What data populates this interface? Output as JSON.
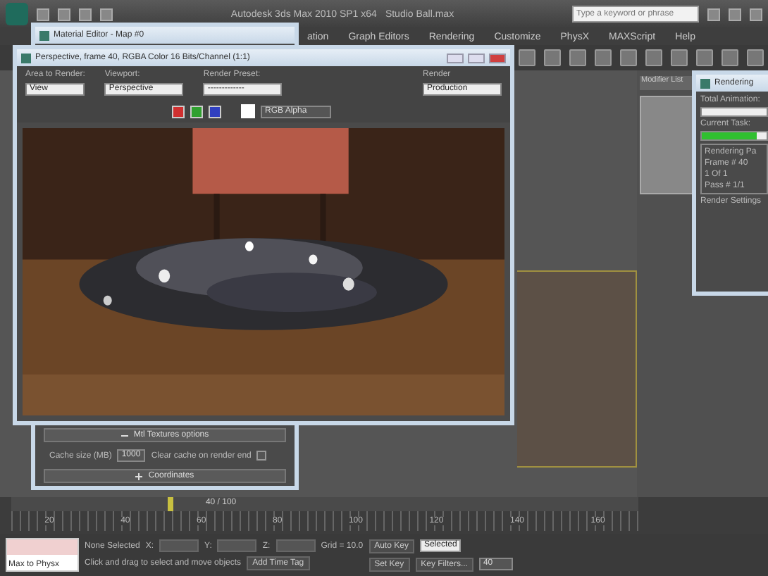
{
  "app": {
    "title": "Autodesk 3ds Max 2010 SP1 x64",
    "file": "Studio Ball.max",
    "search": {
      "placeholder": "Type a keyword or phrase"
    }
  },
  "menu": [
    "ation",
    "Graph Editors",
    "Rendering",
    "Customize",
    "PhysX",
    "MAXScript",
    "Help"
  ],
  "material_editor": {
    "title": "Material Editor - Map #0",
    "rollouts": [
      {
        "title": "Mtl Textures options",
        "expanded": true
      },
      {
        "title": "Coordinates",
        "expanded": false
      }
    ],
    "cache_label": "Cache size (MB)",
    "cache_value": "1000",
    "clear_label": "Clear cache on render end",
    "clear_checked": false
  },
  "frame_window": {
    "title": "Perspective, frame 40, RGBA Color 16 Bits/Channel (1:1)",
    "area_label": "Area to Render:",
    "area_value": "View",
    "viewport_label": "Viewport:",
    "viewport_value": "Perspective",
    "preset_label": "Render Preset:",
    "preset_value": "-------------",
    "render_label": "Render",
    "render_value": "Production",
    "channels": [
      {
        "color": "#d03030",
        "on": true
      },
      {
        "color": "#30a030",
        "on": true
      },
      {
        "color": "#3040c0",
        "on": true
      }
    ],
    "channel_mode": "RGB Alpha"
  },
  "command_panel": {
    "label": "Modifier List"
  },
  "rendering_dialog": {
    "title": "Rendering",
    "total_label": "Total Animation:",
    "total": {
      "level": 0.0
    },
    "task_label": "Current Task:",
    "task": {
      "level": 0.85
    },
    "group_title": "Rendering Pa",
    "frame": "Frame # 40",
    "of": "1 Of 1",
    "pass": "Pass # 1/1",
    "settings_title": "Render Settings"
  },
  "timeline": {
    "position": "40 / 100",
    "ticks": [
      "20",
      "40",
      "60",
      "80",
      "100",
      "120",
      "140",
      "160"
    ],
    "level": 0.25
  },
  "status": {
    "script_box": "Max to Physx",
    "selection": "None Selected",
    "x_label": "X:",
    "y_label": "Y:",
    "z_label": "Z:",
    "grid": "Grid = 10.0",
    "auto_key": "Auto Key",
    "key_mode": "Selected",
    "set_key": "Set Key",
    "key_filters": "Key Filters...",
    "prompt": "Click and drag to select and move objects",
    "time_tag": "Add Time Tag",
    "frame": "40"
  }
}
